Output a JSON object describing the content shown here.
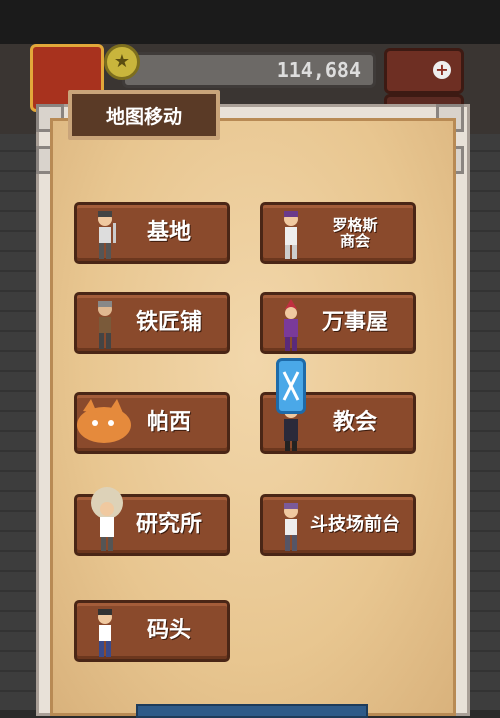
{
  "hud": {
    "currency_value": "114,684"
  },
  "dialog": {
    "title": "地图移动"
  },
  "destinations": [
    {
      "label": "基地",
      "avatar": "soldier-avatar",
      "size": "big"
    },
    {
      "label": "罗格斯\n商会",
      "avatar": "merchant-avatar",
      "size": "small"
    },
    {
      "label": "铁匠铺",
      "avatar": "blacksmith-avatar",
      "size": "big"
    },
    {
      "label": "万事屋",
      "avatar": "jester-avatar",
      "size": "big"
    },
    {
      "label": "帕西",
      "avatar": "orange-beast-avatar",
      "size": "big"
    },
    {
      "label": "教会",
      "avatar": "priest-avatar",
      "size": "big"
    },
    {
      "label": "研究所",
      "avatar": "scientist-avatar",
      "size": "big"
    },
    {
      "label": "斗技场前台",
      "avatar": "arena-clerk-avatar",
      "size": "mid"
    },
    {
      "label": "码头",
      "avatar": "sailor-avatar",
      "size": "big"
    }
  ],
  "colors": {
    "tile": "#8a4a2c",
    "tile_border": "#4a2616",
    "paper": "#f2d7ab",
    "title_plate": "#5a3a26",
    "ui_marker": "#4aa8e8"
  }
}
